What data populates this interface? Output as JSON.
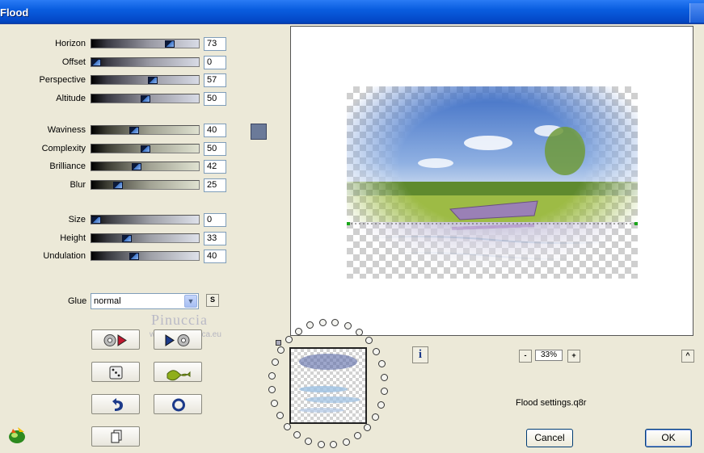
{
  "window": {
    "title": "Flood"
  },
  "groups": [
    [
      {
        "label": "Horizon",
        "value": "73",
        "fraction": 0.73,
        "style": "g1"
      },
      {
        "label": "Offset",
        "value": "0",
        "fraction": 0.0,
        "style": "g1"
      },
      {
        "label": "Perspective",
        "value": "57",
        "fraction": 0.57,
        "style": "g1"
      },
      {
        "label": "Altitude",
        "value": "50",
        "fraction": 0.5,
        "style": "g1"
      }
    ],
    [
      {
        "label": "Waviness",
        "value": "40",
        "fraction": 0.4,
        "style": "g2"
      },
      {
        "label": "Complexity",
        "value": "50",
        "fraction": 0.5,
        "style": "g2"
      },
      {
        "label": "Brilliance",
        "value": "42",
        "fraction": 0.42,
        "style": "g2"
      },
      {
        "label": "Blur",
        "value": "25",
        "fraction": 0.25,
        "style": "g2"
      }
    ],
    [
      {
        "label": "Size",
        "value": "0",
        "fraction": 0.0,
        "style": "g3"
      },
      {
        "label": "Height",
        "value": "33",
        "fraction": 0.33,
        "style": "g3"
      },
      {
        "label": "Undulation",
        "value": "40",
        "fraction": 0.4,
        "style": "g3"
      }
    ]
  ],
  "color_swatch": "#6b7a99",
  "glue": {
    "label": "Glue",
    "value": "normal",
    "s_button": "S"
  },
  "watermark": {
    "name": "Pinuccia",
    "site": "www.maisgrafica.eu"
  },
  "tool_buttons": [
    "reset-play-icon",
    "play-reset-icon",
    "random-dice-icon",
    "wave-icon",
    "undo-icon",
    "circle-icon",
    "copy-icon"
  ],
  "preview": {
    "zoom": "33%",
    "info_label": "i",
    "minus_label": "-",
    "plus_label": "+",
    "collapse_label": "^"
  },
  "status": {
    "settings_file": "Flood settings.q8r"
  },
  "buttons": {
    "cancel": "Cancel",
    "ok": "OK"
  }
}
